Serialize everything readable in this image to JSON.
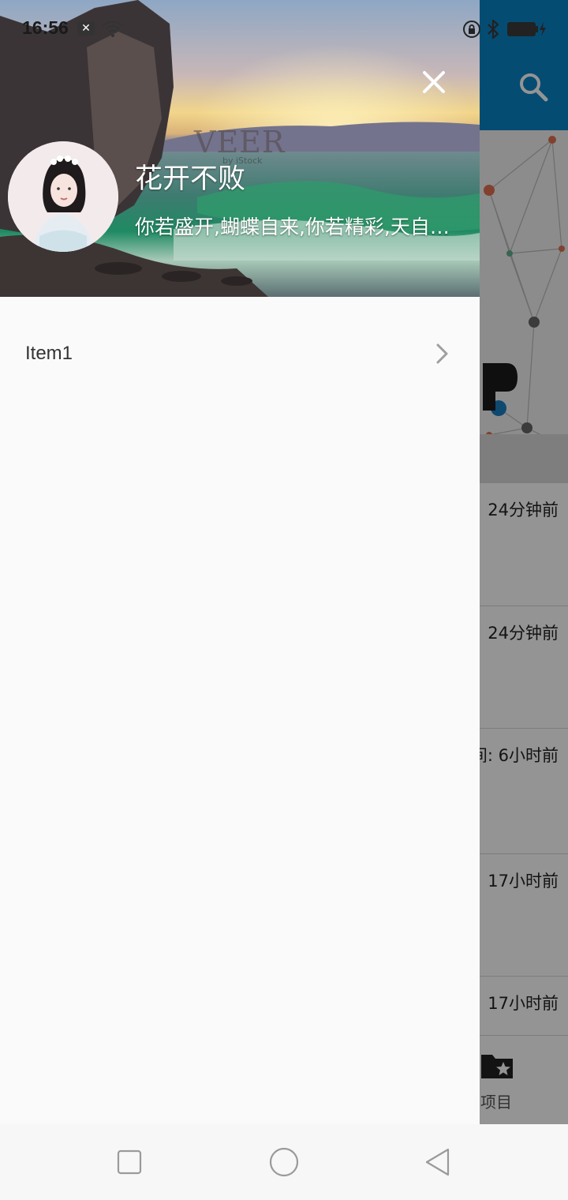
{
  "status_bar": {
    "time": "16:56",
    "notification_icon": "close-box-icon",
    "wifi_icon": "wifi-icon",
    "lock_icon": "lock-rotation-icon",
    "bluetooth_icon": "bluetooth-icon",
    "battery_icon": "battery-charging-icon"
  },
  "background_app": {
    "appbar_color": "#0a84c6",
    "search_icon": "search-icon",
    "list_times": [
      "24分钟前",
      "24分钟前",
      "间: 6小时前",
      "17小时前",
      "17小时前"
    ],
    "tab_label": "项目",
    "tab_icon": "folder-star-icon"
  },
  "drawer": {
    "header": {
      "close_icon": "close-icon",
      "user_name": "花开不败",
      "motto": "你若盛开,蝴蝶自来,你若精彩,天自安排",
      "watermark": "VEER",
      "watermark_sub": "by iStock"
    },
    "menu": [
      {
        "label": "Item1",
        "icon": "chevron-right-icon"
      }
    ]
  },
  "nav_bar": {
    "recents_icon": "square-icon",
    "home_icon": "circle-icon",
    "back_icon": "triangle-back-icon"
  }
}
